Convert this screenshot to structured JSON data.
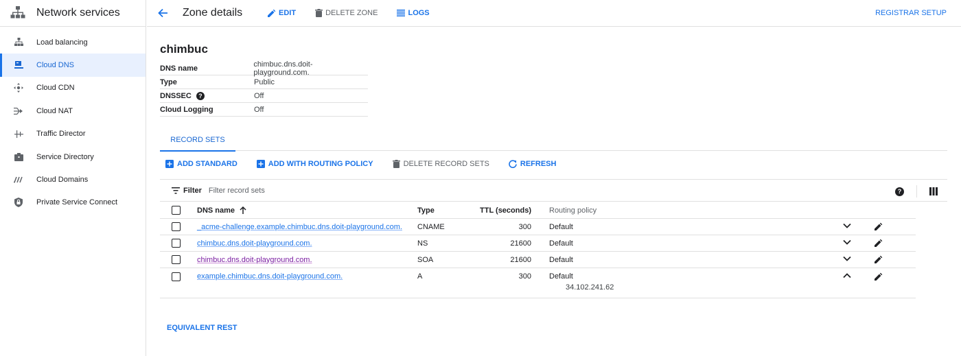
{
  "sidebar": {
    "title": "Network services",
    "items": [
      {
        "label": "Load balancing",
        "icon": "load-balancing-icon"
      },
      {
        "label": "Cloud DNS",
        "icon": "cloud-dns-icon",
        "active": true
      },
      {
        "label": "Cloud CDN",
        "icon": "cloud-cdn-icon"
      },
      {
        "label": "Cloud NAT",
        "icon": "cloud-nat-icon"
      },
      {
        "label": "Traffic Director",
        "icon": "traffic-director-icon"
      },
      {
        "label": "Service Directory",
        "icon": "service-directory-icon"
      },
      {
        "label": "Cloud Domains",
        "icon": "cloud-domains-icon"
      },
      {
        "label": "Private Service Connect",
        "icon": "private-service-connect-icon"
      }
    ]
  },
  "topbar": {
    "title": "Zone details",
    "edit": "EDIT",
    "delete_zone": "DELETE ZONE",
    "logs": "LOGS",
    "registrar_setup": "REGISTRAR SETUP"
  },
  "zone": {
    "name": "chimbuc",
    "details": [
      {
        "key": "DNS name",
        "value": "chimbuc.dns.doit-playground.com."
      },
      {
        "key": "Type",
        "value": "Public"
      },
      {
        "key": "DNSSEC",
        "value": "Off"
      },
      {
        "key": "Cloud Logging",
        "value": "Off"
      }
    ]
  },
  "tabs": {
    "record_sets": "RECORD SETS"
  },
  "actions": {
    "add_standard": "ADD STANDARD",
    "add_routing": "ADD WITH ROUTING POLICY",
    "delete_record_sets": "DELETE RECORD SETS",
    "refresh": "REFRESH"
  },
  "filter": {
    "label": "Filter",
    "placeholder": "Filter record sets"
  },
  "records": {
    "headers": {
      "dns_name": "DNS name",
      "type": "Type",
      "ttl": "TTL (seconds)",
      "policy": "Routing policy"
    },
    "rows": [
      {
        "dns_name": "_acme-challenge.example.chimbuc.dns.doit-playground.com.",
        "type": "CNAME",
        "ttl": "300",
        "policy": "Default"
      },
      {
        "dns_name": "chimbuc.dns.doit-playground.com.",
        "type": "NS",
        "ttl": "21600",
        "policy": "Default"
      },
      {
        "dns_name": "chimbuc.dns.doit-playground.com.",
        "type": "SOA",
        "ttl": "21600",
        "policy": "Default"
      },
      {
        "dns_name": "example.chimbuc.dns.doit-playground.com.",
        "type": "A",
        "ttl": "300",
        "policy": "Default",
        "data": "34.102.241.62"
      }
    ]
  },
  "footer": {
    "equivalent_rest": "EQUIVALENT REST"
  },
  "colors": {
    "accent": "#1a73e8",
    "active_bg": "#e8f0fe",
    "visited": "#7b1fa2"
  }
}
